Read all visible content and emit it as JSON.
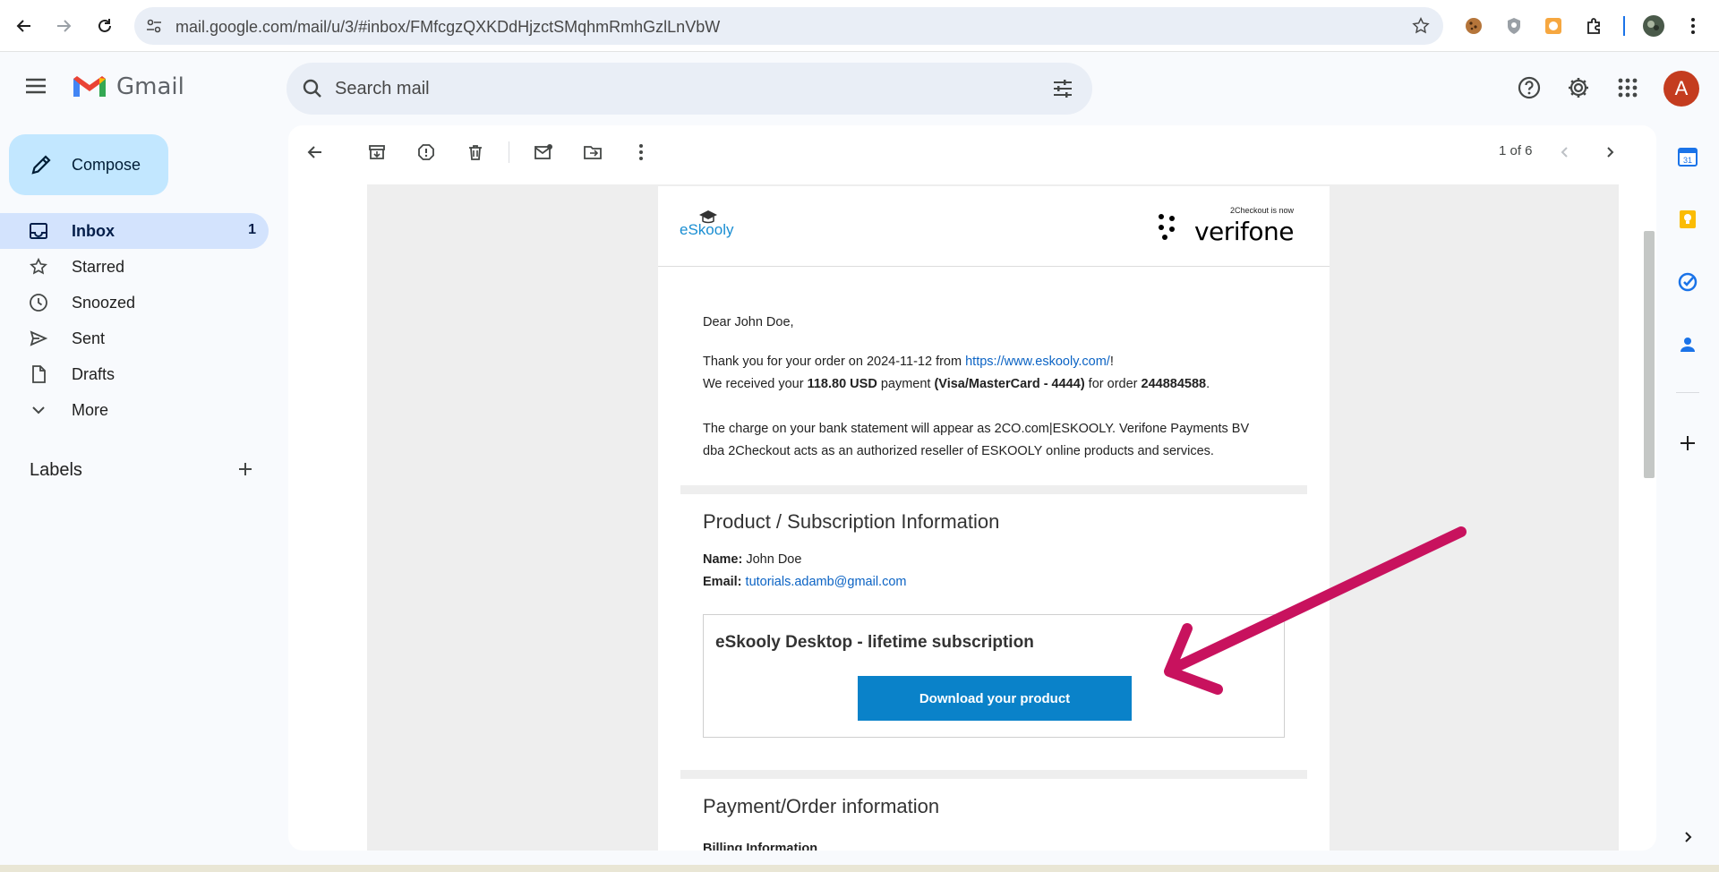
{
  "browser": {
    "url": "mail.google.com/mail/u/3/#inbox/FMfcgzQXKDdHjzctSMqhmRmhGzlLnVbW"
  },
  "gmail": {
    "app_name": "Gmail",
    "search_placeholder": "Search mail",
    "avatar_initial": "A",
    "compose_label": "Compose"
  },
  "sidebar": {
    "items": [
      {
        "label": "Inbox",
        "count": "1",
        "icon": "inbox-icon"
      },
      {
        "label": "Starred",
        "icon": "star-icon"
      },
      {
        "label": "Snoozed",
        "icon": "clock-icon"
      },
      {
        "label": "Sent",
        "icon": "send-icon"
      },
      {
        "label": "Drafts",
        "icon": "draft-icon"
      },
      {
        "label": "More",
        "icon": "chevron-down-icon"
      }
    ],
    "labels_header": "Labels"
  },
  "toolbar": {
    "pager": "1 of 6"
  },
  "email": {
    "logo_text": "eSkooly",
    "brand_tag": "2Checkout is now",
    "brand_name": "verifone",
    "greeting": "Dear John Doe,",
    "thanks_prefix": "Thank you for your order on 2024-11-12 from ",
    "site_link": "https://www.eskooly.com/",
    "thanks_suffix": "!",
    "received_prefix": "We received your ",
    "amount": "118.80 USD",
    "payment_word": " payment ",
    "method": "(Visa/MasterCard - 4444)",
    "for_order": " for order ",
    "order_number": "244884588",
    "period": ".",
    "charge_line_1": "The charge on your bank statement will appear as 2CO.com|ESKOOLY. Verifone Payments BV",
    "charge_line_2": "dba 2Checkout acts as an authorized reseller of ESKOOLY online products and services.",
    "product_section_title": "Product / Subscription Information",
    "name_label": "Name:",
    "name_value": "John Doe",
    "email_label": "Email:",
    "email_value": "tutorials.adamb@gmail.com",
    "product_title": "eSkooly Desktop - lifetime subscription",
    "download_button": "Download your product",
    "payment_section_title": "Payment/Order information",
    "billing_label": "Billing Information"
  },
  "colors": {
    "compose_bg": "#c2e7ff",
    "inbox_active_bg": "#d3e3fd",
    "download_button_bg": "#0a82c9",
    "annotation_arrow": "#c8125e",
    "avatar_bg": "#c43c1f"
  }
}
